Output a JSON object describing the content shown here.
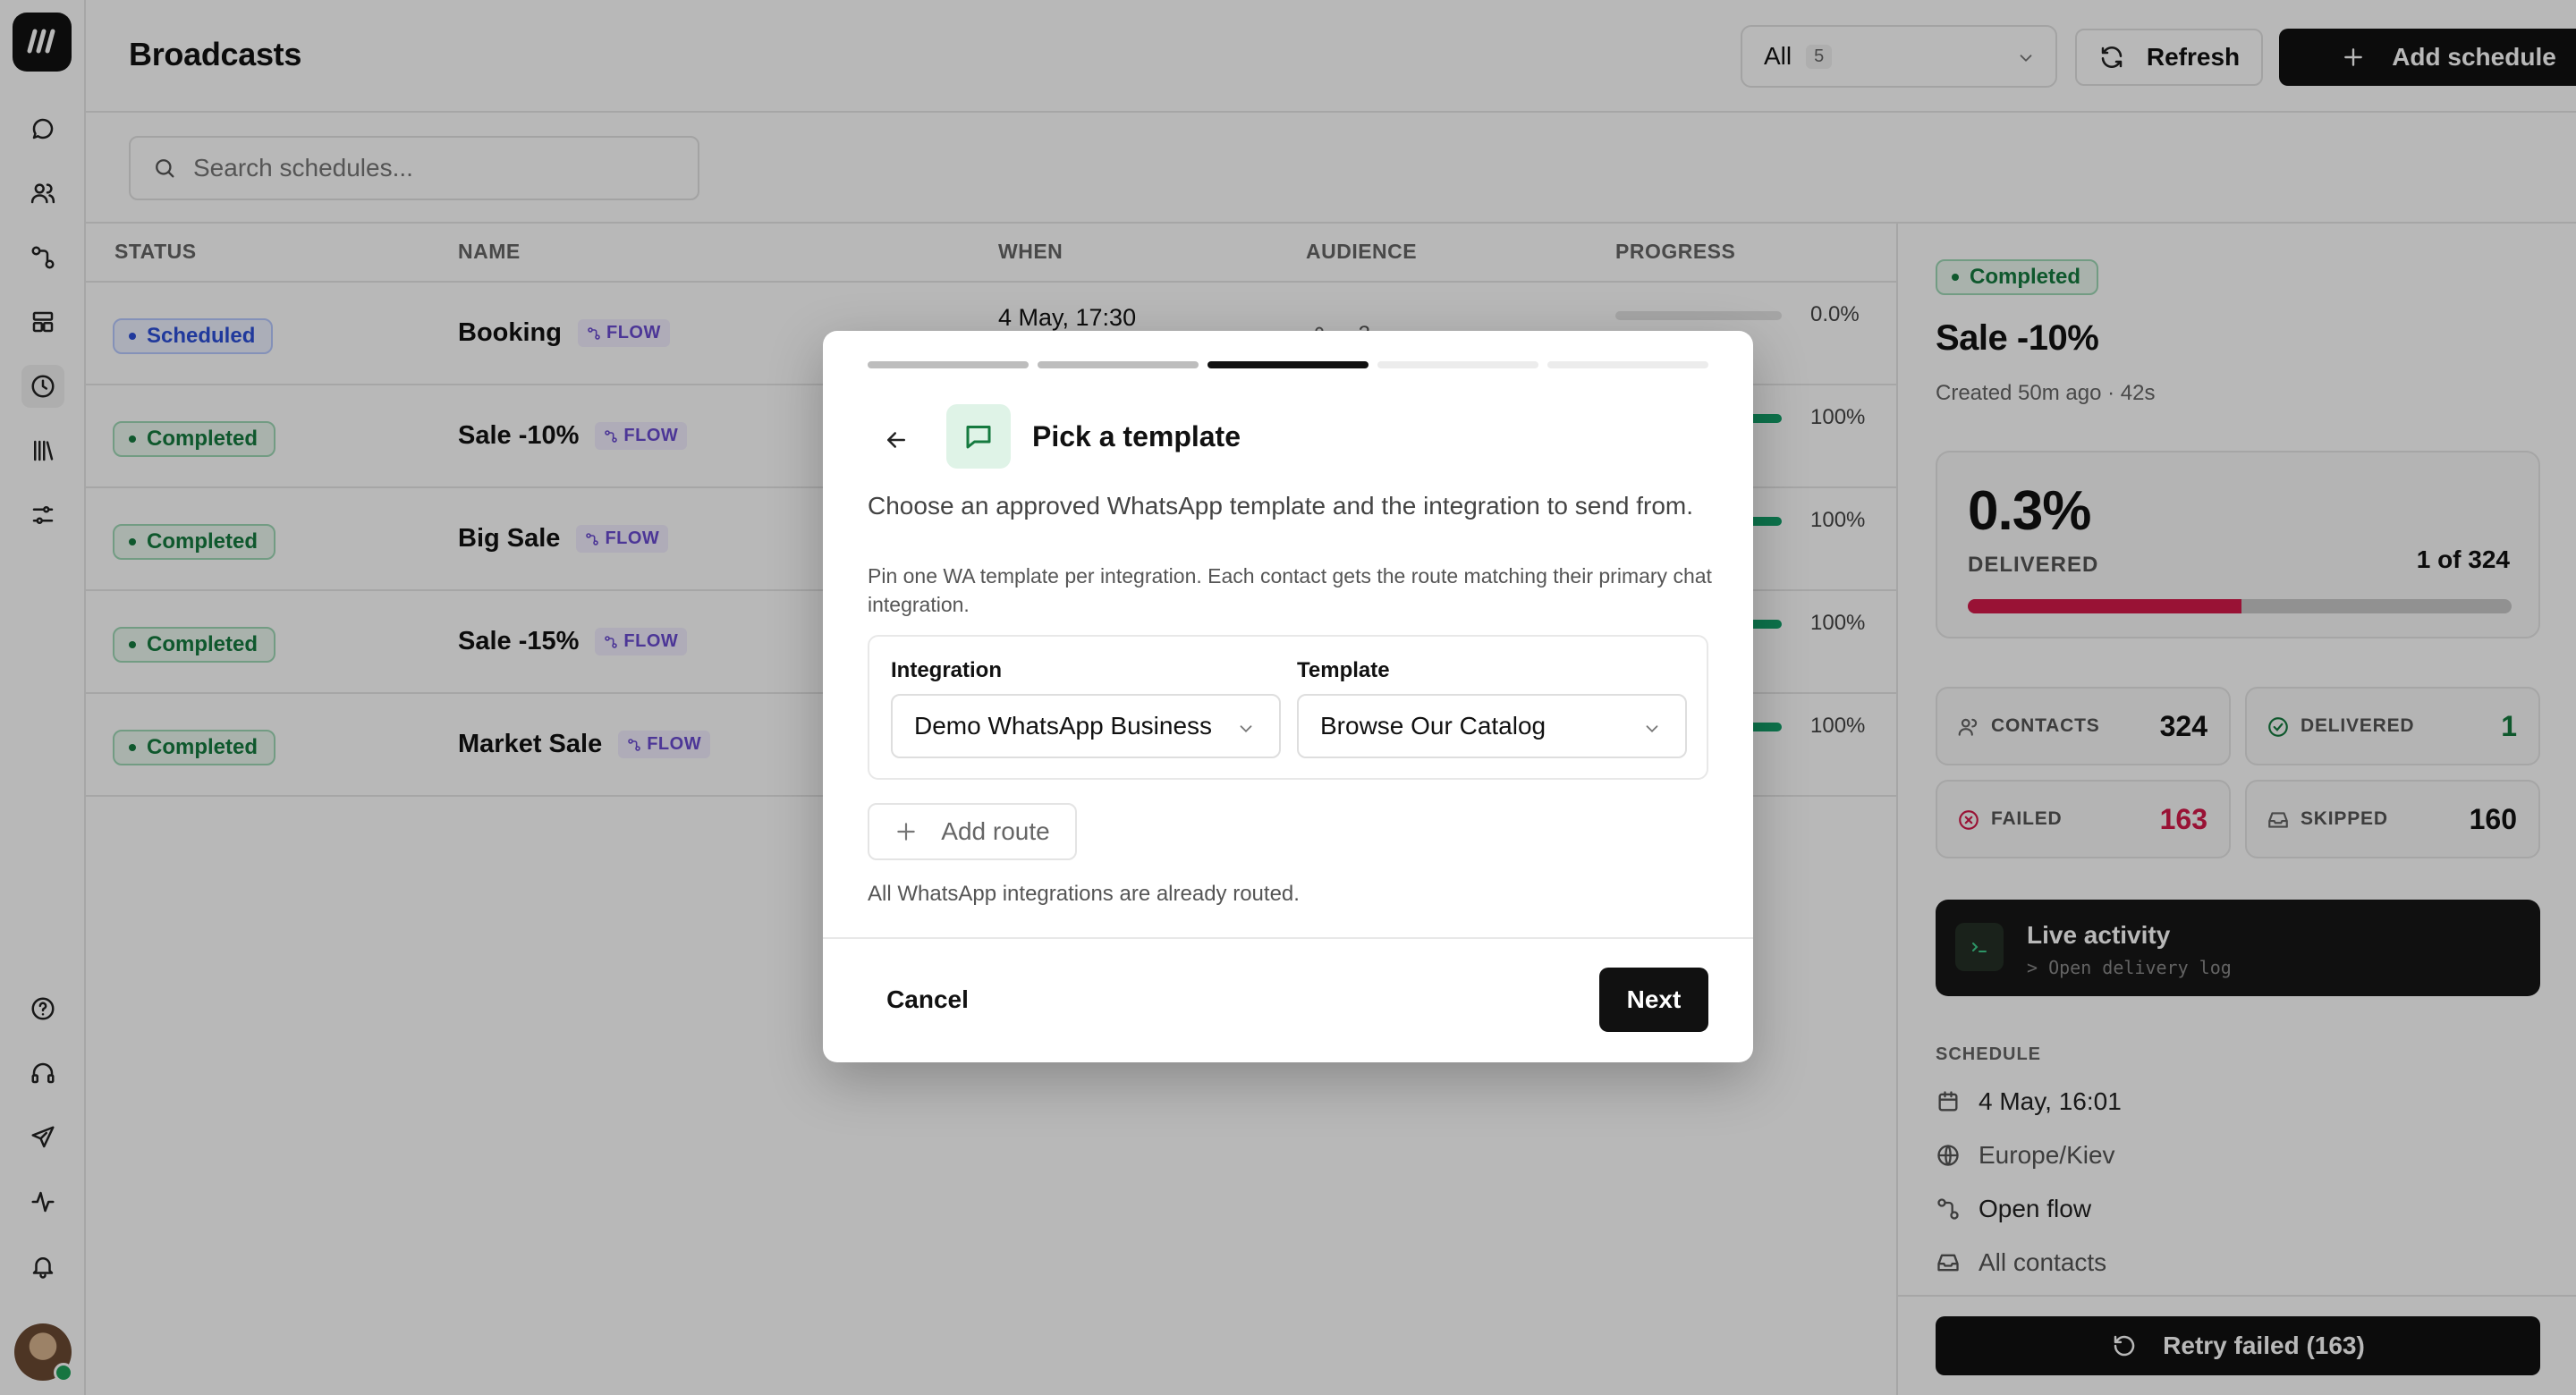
{
  "header": {
    "title": "Broadcasts",
    "filter": {
      "value": "All",
      "count": "5"
    },
    "refresh_label": "Refresh",
    "add_label": "Add schedule"
  },
  "search": {
    "placeholder": "Search schedules..."
  },
  "table": {
    "columns": [
      "STATUS",
      "NAME",
      "WHEN",
      "AUDIENCE",
      "PROGRESS"
    ],
    "rows": [
      {
        "status": "Scheduled",
        "name": "Booking",
        "tag": "FLOW",
        "when": "4 May, 17:30",
        "audience": "~ 2",
        "progress": 0.0,
        "progress_label": "0.0%"
      },
      {
        "status": "Completed",
        "name": "Sale -10%",
        "tag": "FLOW",
        "when": "",
        "audience": "",
        "progress": 1.0,
        "progress_label": "100%"
      },
      {
        "status": "Completed",
        "name": "Big Sale",
        "tag": "FLOW",
        "when": "",
        "audience": "",
        "progress": 1.0,
        "progress_label": "100%"
      },
      {
        "status": "Completed",
        "name": "Sale -15%",
        "tag": "FLOW",
        "when": "",
        "audience": "",
        "progress": 1.0,
        "progress_label": "100%"
      },
      {
        "status": "Completed",
        "name": "Market Sale",
        "tag": "FLOW",
        "when": "",
        "audience": "",
        "progress": 1.0,
        "progress_label": "100%"
      }
    ]
  },
  "panel": {
    "status": "Completed",
    "title": "Sale -10%",
    "meta": "Created 50m ago · 42s",
    "delivered_pct": "0.3%",
    "delivered_label": "DELIVERED",
    "delivered_of": "1 of 324",
    "failed_share": 0.503,
    "stats": {
      "contacts": {
        "label": "CONTACTS",
        "value": "324"
      },
      "delivered": {
        "label": "DELIVERED",
        "value": "1"
      },
      "failed": {
        "label": "FAILED",
        "value": "163"
      },
      "skipped": {
        "label": "SKIPPED",
        "value": "160"
      }
    },
    "live": {
      "title": "Live activity",
      "subtitle": "> Open delivery log"
    },
    "schedule_heading": "SCHEDULE",
    "schedule": {
      "date": "4 May, 16:01",
      "timezone": "Europe/Kiev",
      "flow": "Open flow",
      "audience": "All contacts"
    },
    "retry_label": "Retry failed (163)"
  },
  "modal": {
    "step_current": 3,
    "step_total": 5,
    "title": "Pick a template",
    "description": "Choose an approved WhatsApp template and the integration to send from.",
    "hint": "Pin one WA template per integration. Each contact gets the route matching their primary chat integration.",
    "integration_label": "Integration",
    "integration_value": "Demo WhatsApp Business",
    "template_label": "Template",
    "template_value": "Browse Our Catalog",
    "add_route_label": "Add route",
    "note": "All WhatsApp integrations are already routed.",
    "cancel_label": "Cancel",
    "next_label": "Next"
  },
  "colors": {
    "accent": "#111111",
    "success": "#157a3f",
    "failed": "#d4194a",
    "progress": "#12a06a",
    "flow_tag": "#6a4bd1"
  }
}
